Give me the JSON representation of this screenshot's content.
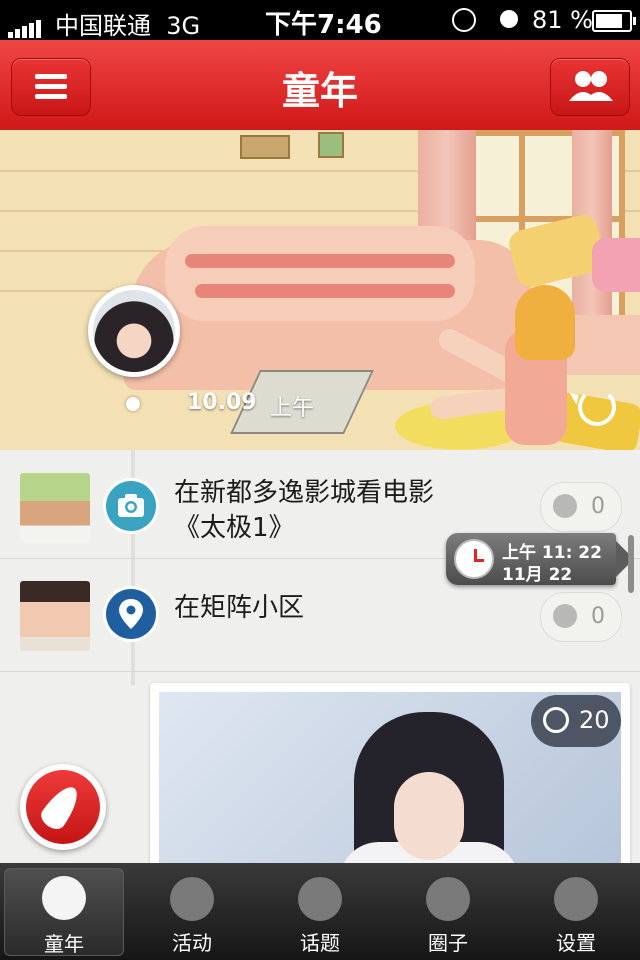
{
  "status_bar": {
    "carrier": "中国联通",
    "network": "3G",
    "time": "下午7:46",
    "battery": "81 %",
    "battery_level": 0.81
  },
  "nav": {
    "title": "童年",
    "menu_icon": "hamburger-icon",
    "right_icon": "friends-icon"
  },
  "hero": {
    "date": "10.09",
    "ampm": "上午"
  },
  "feed": [
    {
      "icon": "camera-icon",
      "text": "在新都多逸影城看电影《太极1》",
      "likes": "0"
    },
    {
      "icon": "location-pin-icon",
      "text": "在矩阵小区",
      "likes": "0"
    }
  ],
  "time_bubble": {
    "time": "上午 11: 22",
    "date": "11月 22"
  },
  "photo_post": {
    "likes": "20"
  },
  "tabs": [
    {
      "label": "童年",
      "icon": "childhood-icon",
      "active": true
    },
    {
      "label": "活动",
      "icon": "footprints-icon",
      "active": false
    },
    {
      "label": "话题",
      "icon": "chat-bubble-icon",
      "active": false
    },
    {
      "label": "圈子",
      "icon": "people-circle-icon",
      "active": false
    },
    {
      "label": "设置",
      "icon": "gear-icon",
      "active": false
    }
  ],
  "colors": {
    "nav_red": "#d8201f",
    "accent_blue": "#3aa3c2",
    "pin_blue": "#1f5fa0"
  }
}
